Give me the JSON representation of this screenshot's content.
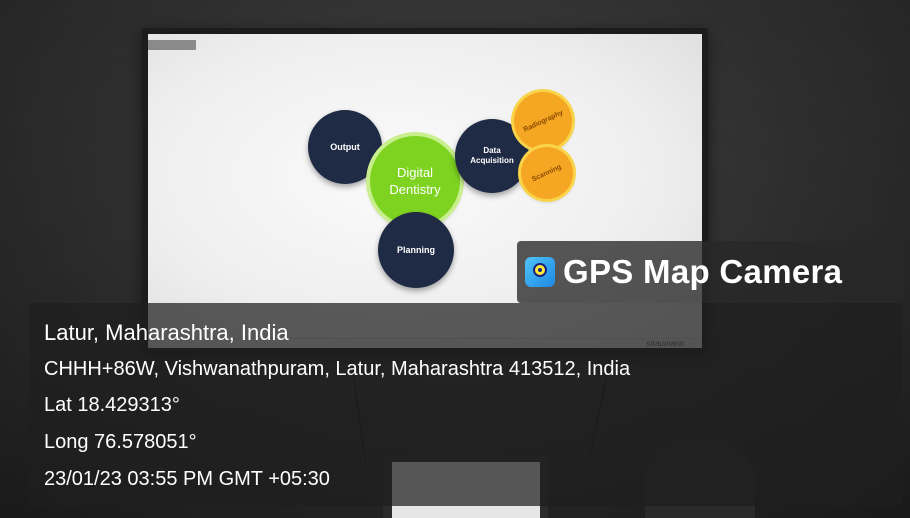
{
  "slide": {
    "center_label": "Digital Dentistry",
    "output_label": "Output",
    "data_acquisition_label": "Data Acquisition",
    "planning_label": "Planning",
    "radiography_label": "Radiography",
    "scanning_label": "Scanning",
    "brand_label": "straumann"
  },
  "badge": {
    "icon": "gps-map-camera-app-icon",
    "title": "GPS Map Camera"
  },
  "geotag": {
    "place": "Latur, Maharashtra, India",
    "address": "CHHH+86W, Vishwanathpuram, Latur, Maharashtra 413512, India",
    "lat": "Lat 18.429313°",
    "long": "Long 76.578051°",
    "datetime": "23/01/23 03:55 PM GMT +05:30"
  }
}
